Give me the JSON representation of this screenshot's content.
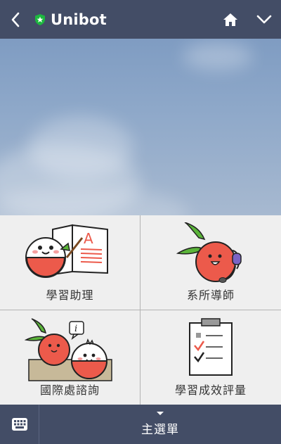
{
  "header": {
    "title": "Unibot",
    "back_icon": "chevron-left-icon",
    "verified_icon": "star-shield-icon",
    "home_icon": "home-icon",
    "expand_icon": "chevron-down-icon",
    "bg_color": "#434d66"
  },
  "menu": {
    "items": [
      {
        "label": "學習助理",
        "icon": "fruit-reading-book-icon"
      },
      {
        "label": "系所導師",
        "icon": "fruit-headset-icon"
      },
      {
        "label": "國際處諮詢",
        "icon": "fruits-info-desk-icon"
      },
      {
        "label": "學習成效評量",
        "icon": "checklist-clipboard-icon"
      }
    ]
  },
  "bottom_bar": {
    "keyboard_icon": "keyboard-icon",
    "main_menu_label": "主選單",
    "caret_icon": "caret-down-icon"
  },
  "colors": {
    "accent_green": "#1db83f",
    "fruit_red": "#ec5a4b",
    "leaf_green": "#5bb53a"
  }
}
